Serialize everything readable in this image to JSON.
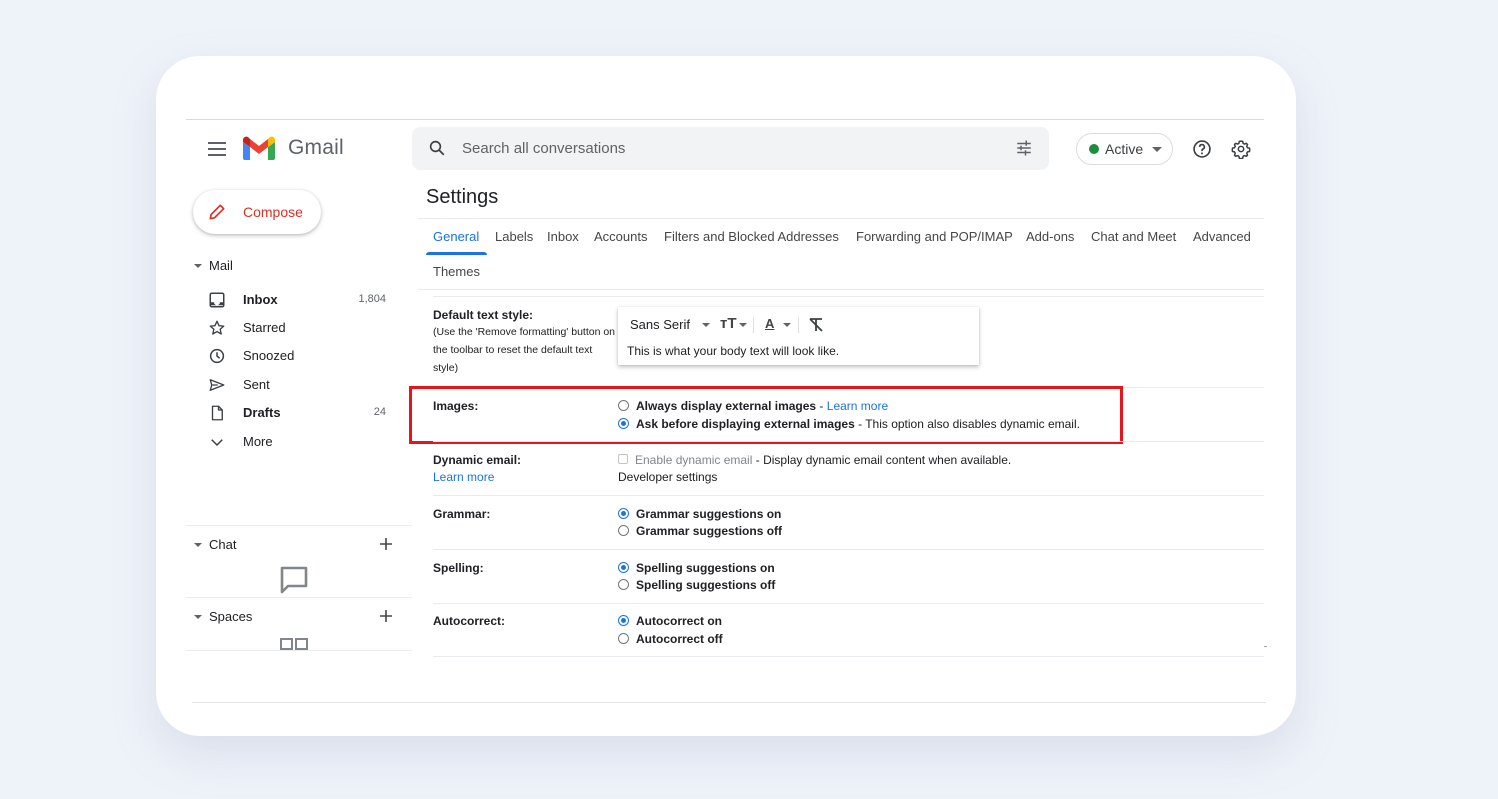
{
  "app": {
    "name": "Gmail",
    "logo_colors": {
      "blue": "#4285f4",
      "red": "#ea4335",
      "yellow": "#fbbc04",
      "green": "#34a853",
      "dark_red": "#c5221f"
    }
  },
  "header": {
    "search": {
      "placeholder": "Search all conversations",
      "value": ""
    },
    "status": {
      "label": "Active",
      "color": "#1e8e3e"
    },
    "icons": [
      "menu-icon",
      "search-icon",
      "tune-icon",
      "help-icon",
      "gear-icon"
    ]
  },
  "sidebar": {
    "compose_label": "Compose",
    "mail_section": "Mail",
    "items": [
      {
        "label": "Inbox",
        "count": "1,804",
        "bold": true,
        "icon": "inbox-icon"
      },
      {
        "label": "Starred",
        "count": "",
        "bold": false,
        "icon": "star-icon"
      },
      {
        "label": "Snoozed",
        "count": "",
        "bold": false,
        "icon": "clock-icon"
      },
      {
        "label": "Sent",
        "count": "",
        "bold": false,
        "icon": "send-icon"
      },
      {
        "label": "Drafts",
        "count": "24",
        "bold": true,
        "icon": "draft-icon"
      },
      {
        "label": "More",
        "count": "",
        "bold": false,
        "icon": "chevron-down-icon"
      }
    ],
    "chat_section": "Chat",
    "spaces_section": "Spaces"
  },
  "settings": {
    "title": "Settings",
    "tabs": [
      {
        "label": "General",
        "active": true
      },
      {
        "label": "Labels",
        "active": false
      },
      {
        "label": "Inbox",
        "active": false
      },
      {
        "label": "Accounts",
        "active": false
      },
      {
        "label": "Filters and Blocked Addresses",
        "active": false
      },
      {
        "label": "Forwarding and POP/IMAP",
        "active": false
      },
      {
        "label": "Add-ons",
        "active": false
      },
      {
        "label": "Chat and Meet",
        "active": false
      },
      {
        "label": "Advanced",
        "active": false
      },
      {
        "label": "Themes",
        "active": false
      }
    ],
    "default_text_style": {
      "label": "Default text style:",
      "help": "(Use the 'Remove formatting' button on the toolbar to reset the default text style)",
      "font": "Sans Serif",
      "size_glyph": "тT",
      "color_glyph": "A",
      "preview": "This is what your body text will look like."
    },
    "images": {
      "label": "Images:",
      "options": [
        {
          "label": "Always display external images",
          "suffix_sep": " - ",
          "link": "Learn more",
          "selected": false
        },
        {
          "label": "Ask before displaying external images",
          "suffix": " - This option also disables dynamic email.",
          "selected": true
        }
      ],
      "highlight_color": "#e8141c"
    },
    "dynamic_email": {
      "label": "Dynamic email:",
      "learn_more": "Learn more",
      "checkbox_label": "Enable dynamic email",
      "checkbox_suffix": " - Display dynamic email content when available.",
      "checked": false,
      "disabled": true,
      "developer_link": "Developer settings"
    },
    "grammar": {
      "label": "Grammar:",
      "options": [
        {
          "label": "Grammar suggestions on",
          "selected": true
        },
        {
          "label": "Grammar suggestions off",
          "selected": false
        }
      ]
    },
    "spelling": {
      "label": "Spelling:",
      "options": [
        {
          "label": "Spelling suggestions on",
          "selected": true
        },
        {
          "label": "Spelling suggestions off",
          "selected": false
        }
      ]
    },
    "autocorrect": {
      "label": "Autocorrect:",
      "options": [
        {
          "label": "Autocorrect on",
          "selected": true
        },
        {
          "label": "Autocorrect off",
          "selected": false
        }
      ]
    }
  }
}
